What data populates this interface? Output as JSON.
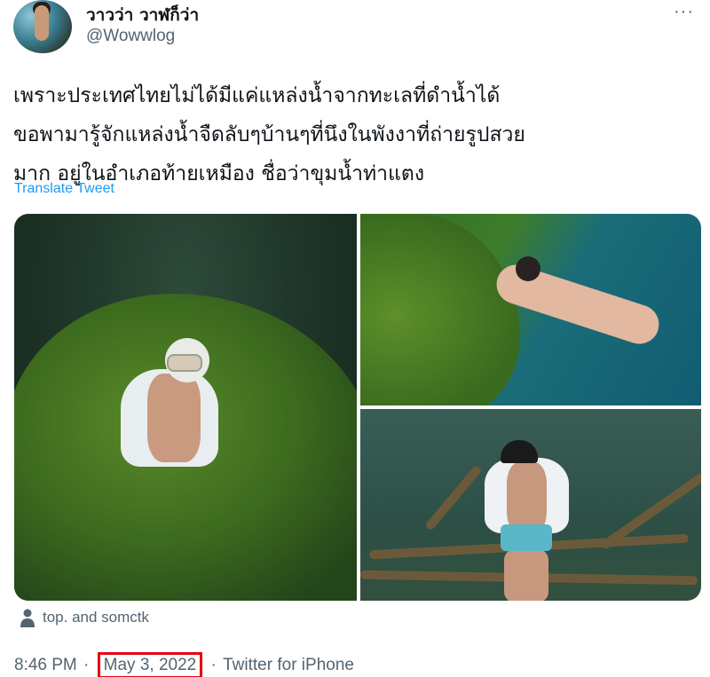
{
  "author": {
    "display_name": "วาวว่า วาฬก็ว่า",
    "handle": "@Wowwlog",
    "avatar_icon": "profile-photo"
  },
  "more_icon": "···",
  "tweet": {
    "lines": [
      "เพราะประเทศไทยไม่ได้มีแค่แหล่งน้ำจากทะเลที่ดำน้ำได้",
      "ขอพามารู้จักแหล่งน้ำจืดลับๆบ้านๆที่นึงในพังงาที่ถ่ายรูปสวย",
      "มาก อยู่ในอำเภอท้ายเหมือง ชื่อว่าขุมน้ำท่าแตง"
    ],
    "translate_label": "Translate Tweet"
  },
  "media": {
    "photos": [
      {
        "name": "underwater-man-moss-photo"
      },
      {
        "name": "underwater-diver-woman-photo"
      },
      {
        "name": "underwater-man-logs-photo"
      }
    ]
  },
  "tagged": {
    "icon": "person-icon",
    "text": "top. and somctk"
  },
  "meta": {
    "time": "8:46 PM",
    "sep1": "·",
    "date": "May 3, 2022",
    "sep2": "·",
    "client": "Twitter for iPhone",
    "highlight_color": "#e30613"
  },
  "colors": {
    "link": "#1d9bf0",
    "secondary_text": "#536471",
    "primary_text": "#0f1419"
  }
}
